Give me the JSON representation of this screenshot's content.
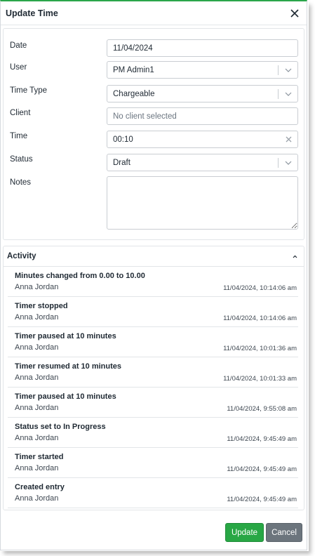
{
  "dialog": {
    "title": "Update Time"
  },
  "form": {
    "date_label": "Date",
    "date_value": "11/04/2024",
    "user_label": "User",
    "user_value": "PM Admin1",
    "time_type_label": "Time Type",
    "time_type_value": "Chargeable",
    "client_label": "Client",
    "client_placeholder": "No client selected",
    "time_label": "Time",
    "time_value": "00:10",
    "status_label": "Status",
    "status_value": "Draft",
    "notes_label": "Notes",
    "notes_value": ""
  },
  "activity": {
    "title": "Activity",
    "items": [
      {
        "title": "Minutes changed from 0.00 to 10.00",
        "user": "Anna Jordan",
        "timestamp": "11/04/2024, 10:14:06 am"
      },
      {
        "title": "Timer stopped",
        "user": "Anna Jordan",
        "timestamp": "11/04/2024, 10:14:06 am"
      },
      {
        "title": "Timer paused at 10 minutes",
        "user": "Anna Jordan",
        "timestamp": "11/04/2024, 10:01:36 am"
      },
      {
        "title": "Timer resumed at 10 minutes",
        "user": "Anna Jordan",
        "timestamp": "11/04/2024, 10:01:33 am"
      },
      {
        "title": "Timer paused at 10 minutes",
        "user": "Anna Jordan",
        "timestamp": "11/04/2024, 9:55:08 am"
      },
      {
        "title": "Status set to In Progress",
        "user": "Anna Jordan",
        "timestamp": "11/04/2024, 9:45:49 am"
      },
      {
        "title": "Timer started",
        "user": "Anna Jordan",
        "timestamp": "11/04/2024, 9:45:49 am"
      },
      {
        "title": "Created entry",
        "user": "Anna Jordan",
        "timestamp": "11/04/2024, 9:45:49 am"
      }
    ]
  },
  "footer": {
    "update_label": "Update",
    "cancel_label": "Cancel"
  },
  "colors": {
    "accent": "#28a745",
    "secondary": "#6c757d",
    "border": "#c9cdd2"
  }
}
